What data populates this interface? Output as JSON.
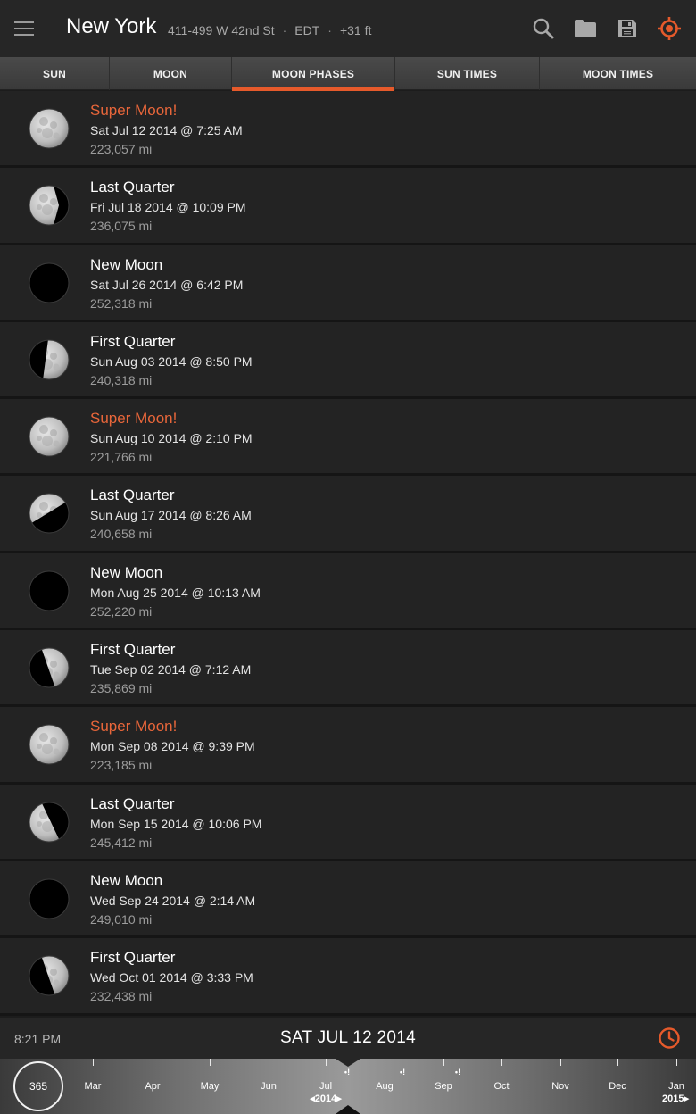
{
  "header": {
    "city": "New York",
    "address": "411-499 W 42nd St",
    "timezone": "EDT",
    "elevation": "+31 ft"
  },
  "tabs": [
    {
      "label": "SUN",
      "active": false
    },
    {
      "label": "MOON",
      "active": false
    },
    {
      "label": "MOON PHASES",
      "active": true
    },
    {
      "label": "SUN TIMES",
      "active": false
    },
    {
      "label": "MOON TIMES",
      "active": false
    }
  ],
  "phases": [
    {
      "name": "Super Moon!",
      "date": "Sat Jul 12 2014 @ 7:25 AM",
      "distance": "223,057 mi",
      "type": "full",
      "super": true
    },
    {
      "name": "Last Quarter",
      "date": "Fri Jul 18 2014 @ 10:09 PM",
      "distance": "236,075 mi",
      "type": "last",
      "super": false
    },
    {
      "name": "New Moon",
      "date": "Sat Jul 26 2014 @ 6:42 PM",
      "distance": "252,318 mi",
      "type": "new",
      "super": false
    },
    {
      "name": "First Quarter",
      "date": "Sun Aug 03 2014 @ 8:50 PM",
      "distance": "240,318 mi",
      "type": "first",
      "super": false
    },
    {
      "name": "Super Moon!",
      "date": "Sun Aug 10 2014 @ 2:10 PM",
      "distance": "221,766 mi",
      "type": "full",
      "super": true
    },
    {
      "name": "Last Quarter",
      "date": "Sun Aug 17 2014 @ 8:26 AM",
      "distance": "240,658 mi",
      "type": "last-tilt",
      "super": false
    },
    {
      "name": "New Moon",
      "date": "Mon Aug 25 2014 @ 10:13 AM",
      "distance": "252,220 mi",
      "type": "new",
      "super": false
    },
    {
      "name": "First Quarter",
      "date": "Tue Sep 02 2014 @ 7:12 AM",
      "distance": "235,869 mi",
      "type": "first-tilt",
      "super": false
    },
    {
      "name": "Super Moon!",
      "date": "Mon Sep 08 2014 @ 9:39 PM",
      "distance": "223,185 mi",
      "type": "full",
      "super": true
    },
    {
      "name": "Last Quarter",
      "date": "Mon Sep 15 2014 @ 10:06 PM",
      "distance": "245,412 mi",
      "type": "last-tilt2",
      "super": false
    },
    {
      "name": "New Moon",
      "date": "Wed Sep 24 2014 @ 2:14 AM",
      "distance": "249,010 mi",
      "type": "new",
      "super": false
    },
    {
      "name": "First Quarter",
      "date": "Wed Oct 01 2014 @ 3:33 PM",
      "distance": "232,438 mi",
      "type": "first-tilt",
      "super": false
    }
  ],
  "bottom": {
    "time": "8:21 PM",
    "date": "SAT JUL 12 2014"
  },
  "timeline": {
    "days": "365",
    "months": [
      "Mar",
      "Apr",
      "May",
      "Jun",
      "Jul",
      "Aug",
      "Sep",
      "Oct",
      "Nov",
      "Dec",
      "Jan"
    ],
    "year_current": "◂2014▸",
    "year_next": "2015▸",
    "marker": "•!"
  },
  "colors": {
    "accent": "#e65a2b",
    "super_moon": "#e8663a"
  }
}
